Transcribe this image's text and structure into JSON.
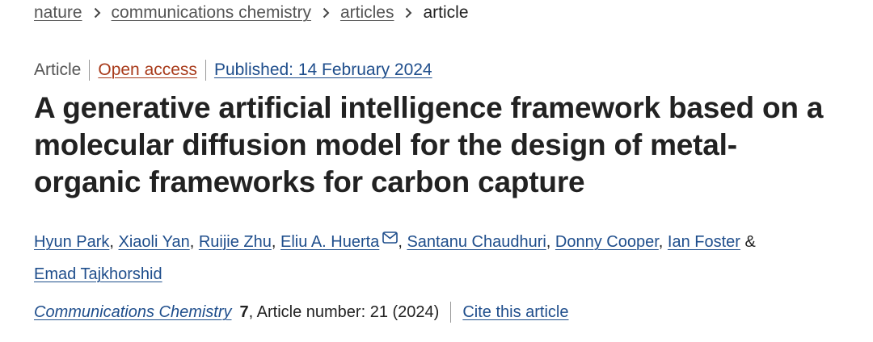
{
  "breadcrumb": {
    "items": [
      "nature",
      "communications chemistry",
      "articles"
    ],
    "current": "article"
  },
  "meta": {
    "type": "Article",
    "access": "Open access",
    "published": "Published: 14 February 2024"
  },
  "title": "A generative artificial intelligence framework based on a molecular diffusion model for the design of metal-organic frameworks for carbon capture",
  "authors": {
    "list": [
      "Hyun Park",
      "Xiaoli Yan",
      "Ruijie Zhu",
      "Eliu A. Huerta",
      "Santanu Chaudhuri",
      "Donny Cooper",
      "Ian Foster",
      "Emad Tajkhorshid"
    ],
    "separator": ",",
    "ampersand": "&",
    "corresponding_icon": "mail-icon"
  },
  "citation": {
    "journal": "Communications Chemistry",
    "volume": "7",
    "details": ", Article number: 21 (2024)",
    "cite_label": "Cite this article"
  },
  "colors": {
    "link": "#1f4e8c",
    "open_access": "#a83a1a",
    "text": "#222222",
    "muted": "#555555"
  },
  "icons": {
    "breadcrumb_separator": "chevron-right-icon"
  }
}
